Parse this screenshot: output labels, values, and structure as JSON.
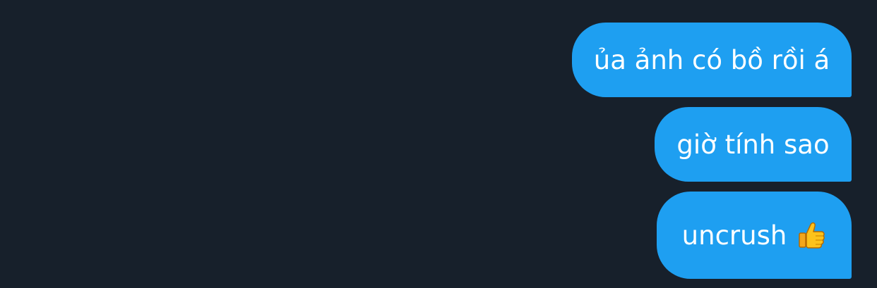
{
  "messages": [
    {
      "text": "ủa ảnh có bồ rồi á",
      "emoji": ""
    },
    {
      "text": "giờ tính sao",
      "emoji": ""
    },
    {
      "text": "uncrush",
      "emoji": "thumbs-up-icon"
    }
  ],
  "colors": {
    "background": "#17202b",
    "bubble": "#1e9ff1",
    "text": "#ffffff"
  }
}
